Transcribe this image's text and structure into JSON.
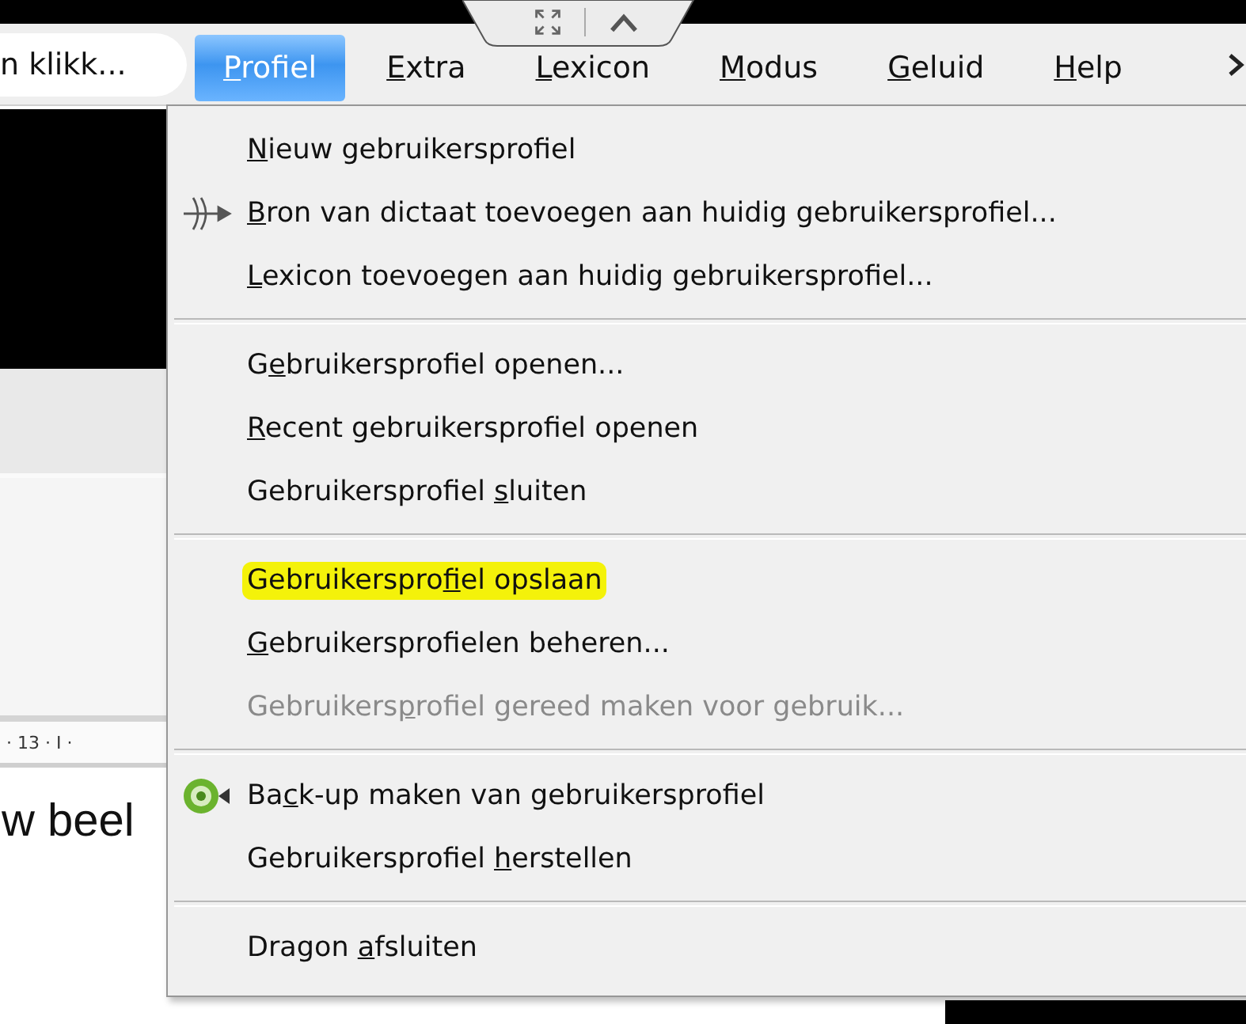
{
  "search": {
    "value": "n klikk..."
  },
  "menubar": [
    {
      "label": {
        "key": "P",
        "post": "rofiel"
      },
      "selected": true
    },
    {
      "label": {
        "key": "E",
        "post": "xtra"
      },
      "selected": false
    },
    {
      "label": {
        "key": "L",
        "post": "exicon"
      },
      "selected": false
    },
    {
      "label": {
        "key": "M",
        "post": "odus"
      },
      "selected": false
    },
    {
      "label": {
        "key": "G",
        "post": "eluid"
      },
      "selected": false
    },
    {
      "label": {
        "key": "H",
        "post": "elp"
      },
      "selected": false
    }
  ],
  "document": {
    "ruler": "· 13 · I ·",
    "text": "w beel"
  },
  "menu": [
    {
      "kind": "item",
      "label": {
        "key": "N",
        "post": "ieuw gebruikersprofiel"
      },
      "disabled": false,
      "highlighted": false
    },
    {
      "kind": "item",
      "label": {
        "key": "B",
        "post": "ron van dictaat toevoegen aan huidig gebruikersprofiel..."
      },
      "disabled": false,
      "highlighted": false
    },
    {
      "kind": "item",
      "label": {
        "key": "L",
        "post": "exicon toevoegen aan huidig gebruikersprofiel..."
      },
      "disabled": false,
      "highlighted": false
    },
    {
      "kind": "separator"
    },
    {
      "kind": "item",
      "label": {
        "pre": "G",
        "key": "e",
        "post": "bruikersprofiel openen..."
      },
      "disabled": false,
      "highlighted": false
    },
    {
      "kind": "item",
      "label": {
        "key": "R",
        "post": "ecent gebruikersprofiel openen"
      },
      "disabled": false,
      "highlighted": false
    },
    {
      "kind": "item",
      "label": {
        "pre": "Gebruikersprofiel ",
        "key": "s",
        "post": "luiten"
      },
      "disabled": false,
      "highlighted": false
    },
    {
      "kind": "separator"
    },
    {
      "kind": "item",
      "label": {
        "pre": "Gebruikerspro",
        "key": "f",
        "post": "iel opslaan"
      },
      "disabled": false,
      "highlighted": true
    },
    {
      "kind": "item",
      "label": {
        "key": "G",
        "post": "ebruikersprofielen beheren..."
      },
      "disabled": false,
      "highlighted": false
    },
    {
      "kind": "item",
      "label": {
        "pre": "Gebruikers",
        "key": "p",
        "post": "rofiel gereed maken voor gebruik..."
      },
      "disabled": true,
      "highlighted": false
    },
    {
      "kind": "separator"
    },
    {
      "kind": "item",
      "label": {
        "pre": "Ba",
        "key": "c",
        "post": "k-up maken van gebruikersprofiel"
      },
      "disabled": false,
      "highlighted": false
    },
    {
      "kind": "item",
      "label": {
        "pre": "Gebruikersprofiel ",
        "key": "h",
        "post": "erstellen"
      },
      "disabled": false,
      "highlighted": false
    },
    {
      "kind": "separator"
    },
    {
      "kind": "item",
      "label": {
        "pre": "Dragon ",
        "key": "a",
        "post": "fsluiten"
      },
      "disabled": false,
      "highlighted": false
    }
  ]
}
